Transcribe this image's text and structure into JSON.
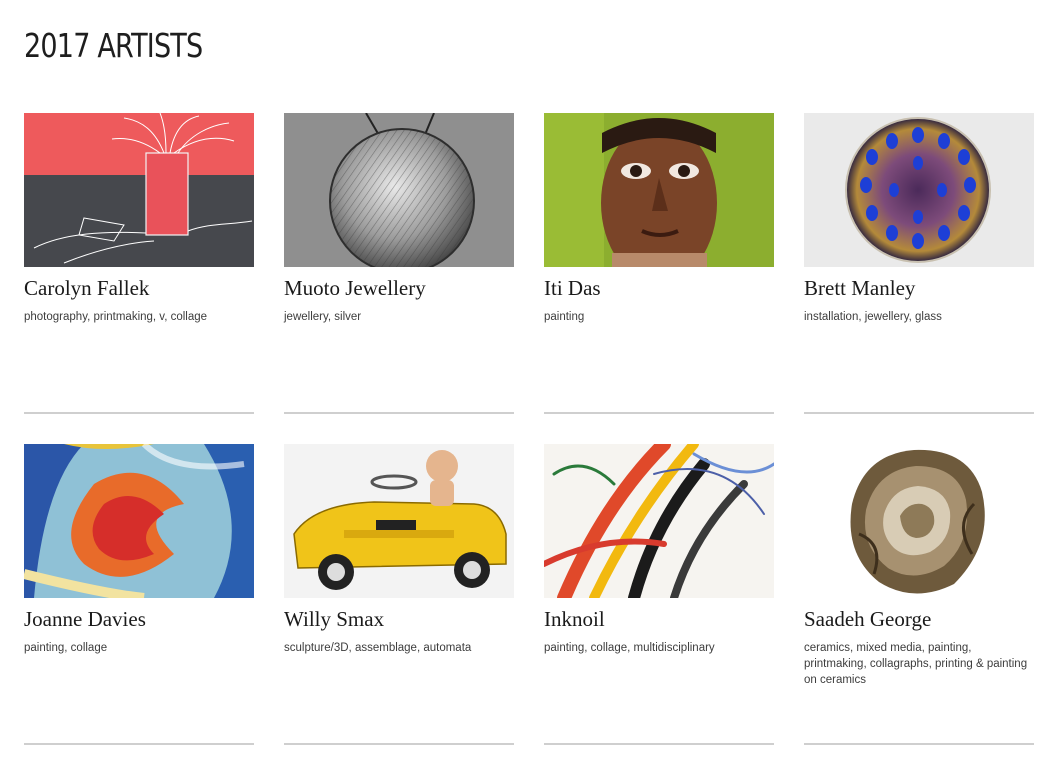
{
  "page": {
    "title": "2017 ARTISTS"
  },
  "artists": [
    {
      "name": "Carolyn Fallek",
      "tags": "photography, printmaking, v, collage",
      "image": "red-vase-drawing"
    },
    {
      "name": "Muoto Jewellery",
      "tags": "jewellery, silver",
      "image": "silver-disc-pendant"
    },
    {
      "name": "Iti Das",
      "tags": "painting",
      "image": "portrait-painting"
    },
    {
      "name": "Brett Manley",
      "tags": "installation, jewellery, glass",
      "image": "iridescent-glass-plate"
    },
    {
      "name": "Joanne Davies",
      "tags": "painting, collage",
      "image": "abstract-heart-painting"
    },
    {
      "name": "Willy Smax",
      "tags": "sculpture/3D, assemblage, automata",
      "image": "pedal-car-sculpture"
    },
    {
      "name": "Inknoil",
      "tags": "painting, collage, multidisciplinary",
      "image": "abstract-stroke-painting"
    },
    {
      "name": "Saadeh George",
      "tags": "ceramics, mixed media, painting, printmaking, collagraphs, printing & painting on ceramics",
      "image": "ceramic-rose"
    }
  ]
}
